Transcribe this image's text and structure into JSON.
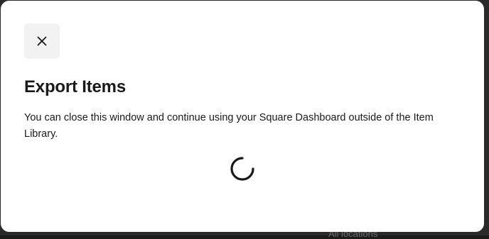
{
  "modal": {
    "close_icon": "close-icon",
    "title": "Export Items",
    "description": "You can close this window and continue using your Square Dashboard outside of the Item Library.",
    "loading_icon": "spinner-icon"
  },
  "background": {
    "partial_text": "All locations"
  },
  "colors": {
    "modal_bg": "#ffffff",
    "close_button_bg": "#f2f2f2",
    "text": "#1a1a1a",
    "backdrop": "#2a2a2a"
  }
}
